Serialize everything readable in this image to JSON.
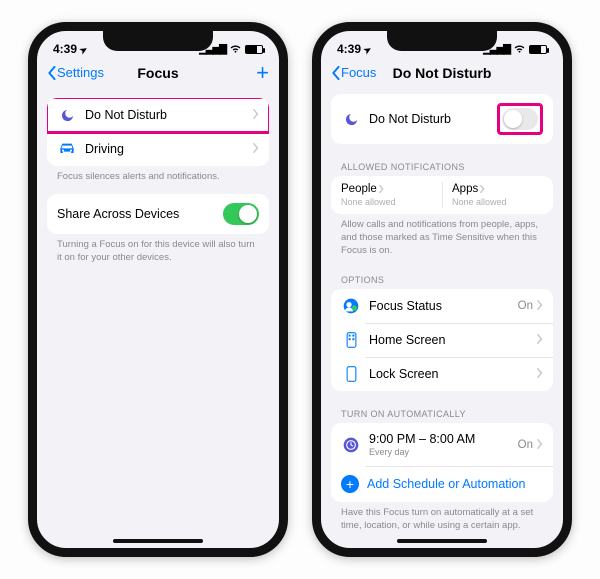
{
  "status": {
    "time": "4:39",
    "loc_arrow": "➤"
  },
  "phone1": {
    "back_label": "Settings",
    "title": "Focus",
    "rows": {
      "dnd": "Do Not Disturb",
      "driving": "Driving"
    },
    "focus_footer": "Focus silences alerts and notifications.",
    "share_label": "Share Across Devices",
    "share_footer": "Turning a Focus on for this device will also turn it on for your other devices."
  },
  "phone2": {
    "back_label": "Focus",
    "title": "Do Not Disturb",
    "dnd_row": "Do Not Disturb",
    "allowed_header": "ALLOWED NOTIFICATIONS",
    "people_label": "People",
    "people_value": "None allowed",
    "apps_label": "Apps",
    "apps_value": "None allowed",
    "allowed_footer": "Allow calls and notifications from people, apps, and those marked as Time Sensitive when this Focus is on.",
    "options_header": "OPTIONS",
    "options": {
      "focus_status": "Focus Status",
      "focus_status_value": "On",
      "home": "Home Screen",
      "lock": "Lock Screen"
    },
    "auto_header": "TURN ON AUTOMATICALLY",
    "schedule_time": "9:00 PM – 8:00 AM",
    "schedule_sub": "Every day",
    "schedule_value": "On",
    "add_label": "Add Schedule or Automation",
    "auto_footer": "Have this Focus turn on automatically at a set time, location, or while using a certain app."
  }
}
